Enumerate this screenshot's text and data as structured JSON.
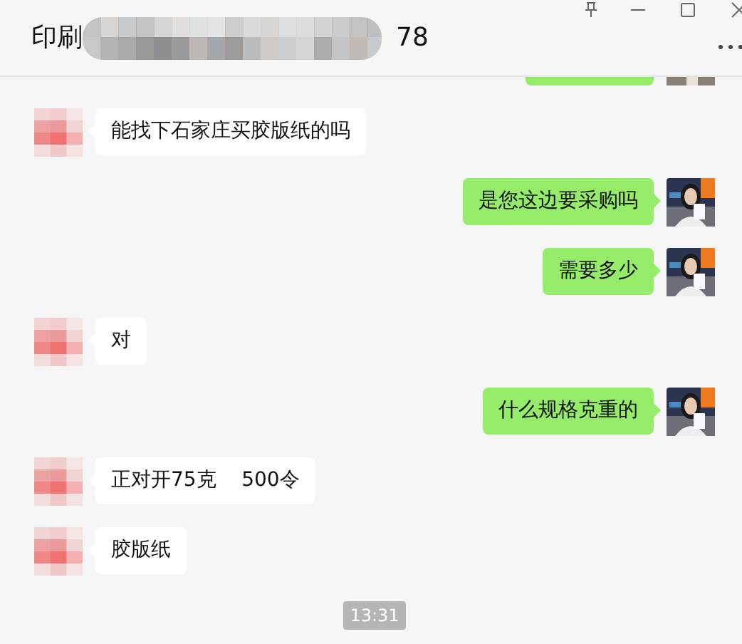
{
  "header": {
    "title_start": "印刷",
    "title_end": "78"
  },
  "messages": [
    {
      "kind": "sent_clipped"
    },
    {
      "kind": "received",
      "text": "能找下石家庄买胶版纸的吗"
    },
    {
      "kind": "sent",
      "text": "是您这边要采购吗"
    },
    {
      "kind": "sent",
      "text": "需要多少"
    },
    {
      "kind": "received",
      "text": "对"
    },
    {
      "kind": "sent",
      "text": "什么规格克重的"
    },
    {
      "kind": "received",
      "text": "正对开75克    500令"
    },
    {
      "kind": "received",
      "text": "胶版纸"
    },
    {
      "kind": "time",
      "text": "13:31"
    }
  ]
}
